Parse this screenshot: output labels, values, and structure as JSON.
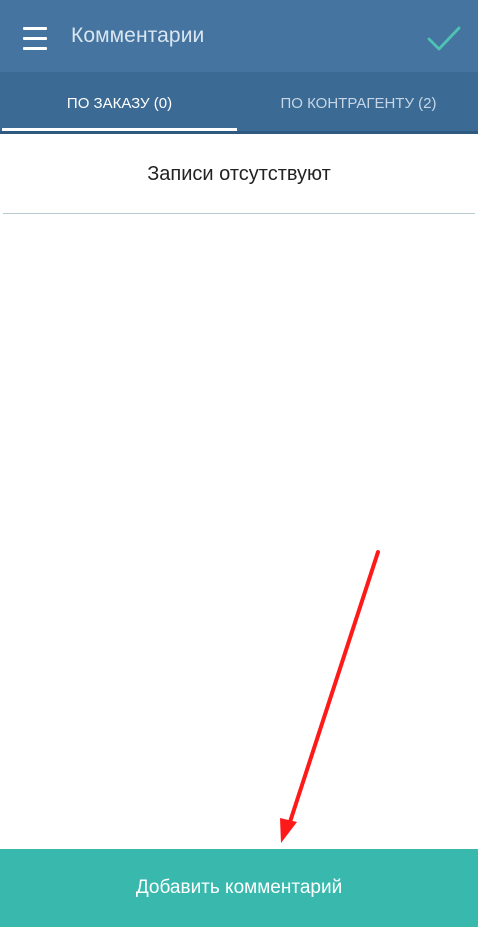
{
  "appbar": {
    "title": "Комментарии",
    "icons": {
      "menu": "menu-icon",
      "confirm": "check-icon"
    },
    "colors": {
      "background": "#44749f",
      "check": "#4ec3b3"
    }
  },
  "tabs": [
    {
      "label": "ПО ЗАКАЗУ (0)",
      "selected": true
    },
    {
      "label": "ПО КОНТРАГЕНТУ (2)",
      "selected": false
    }
  ],
  "content": {
    "empty_text": "Записи отсутствуют"
  },
  "footer": {
    "add_label": "Добавить комментарий",
    "color": "#39b9ad"
  },
  "annotation": {
    "arrow_color": "#ff1a1a"
  }
}
